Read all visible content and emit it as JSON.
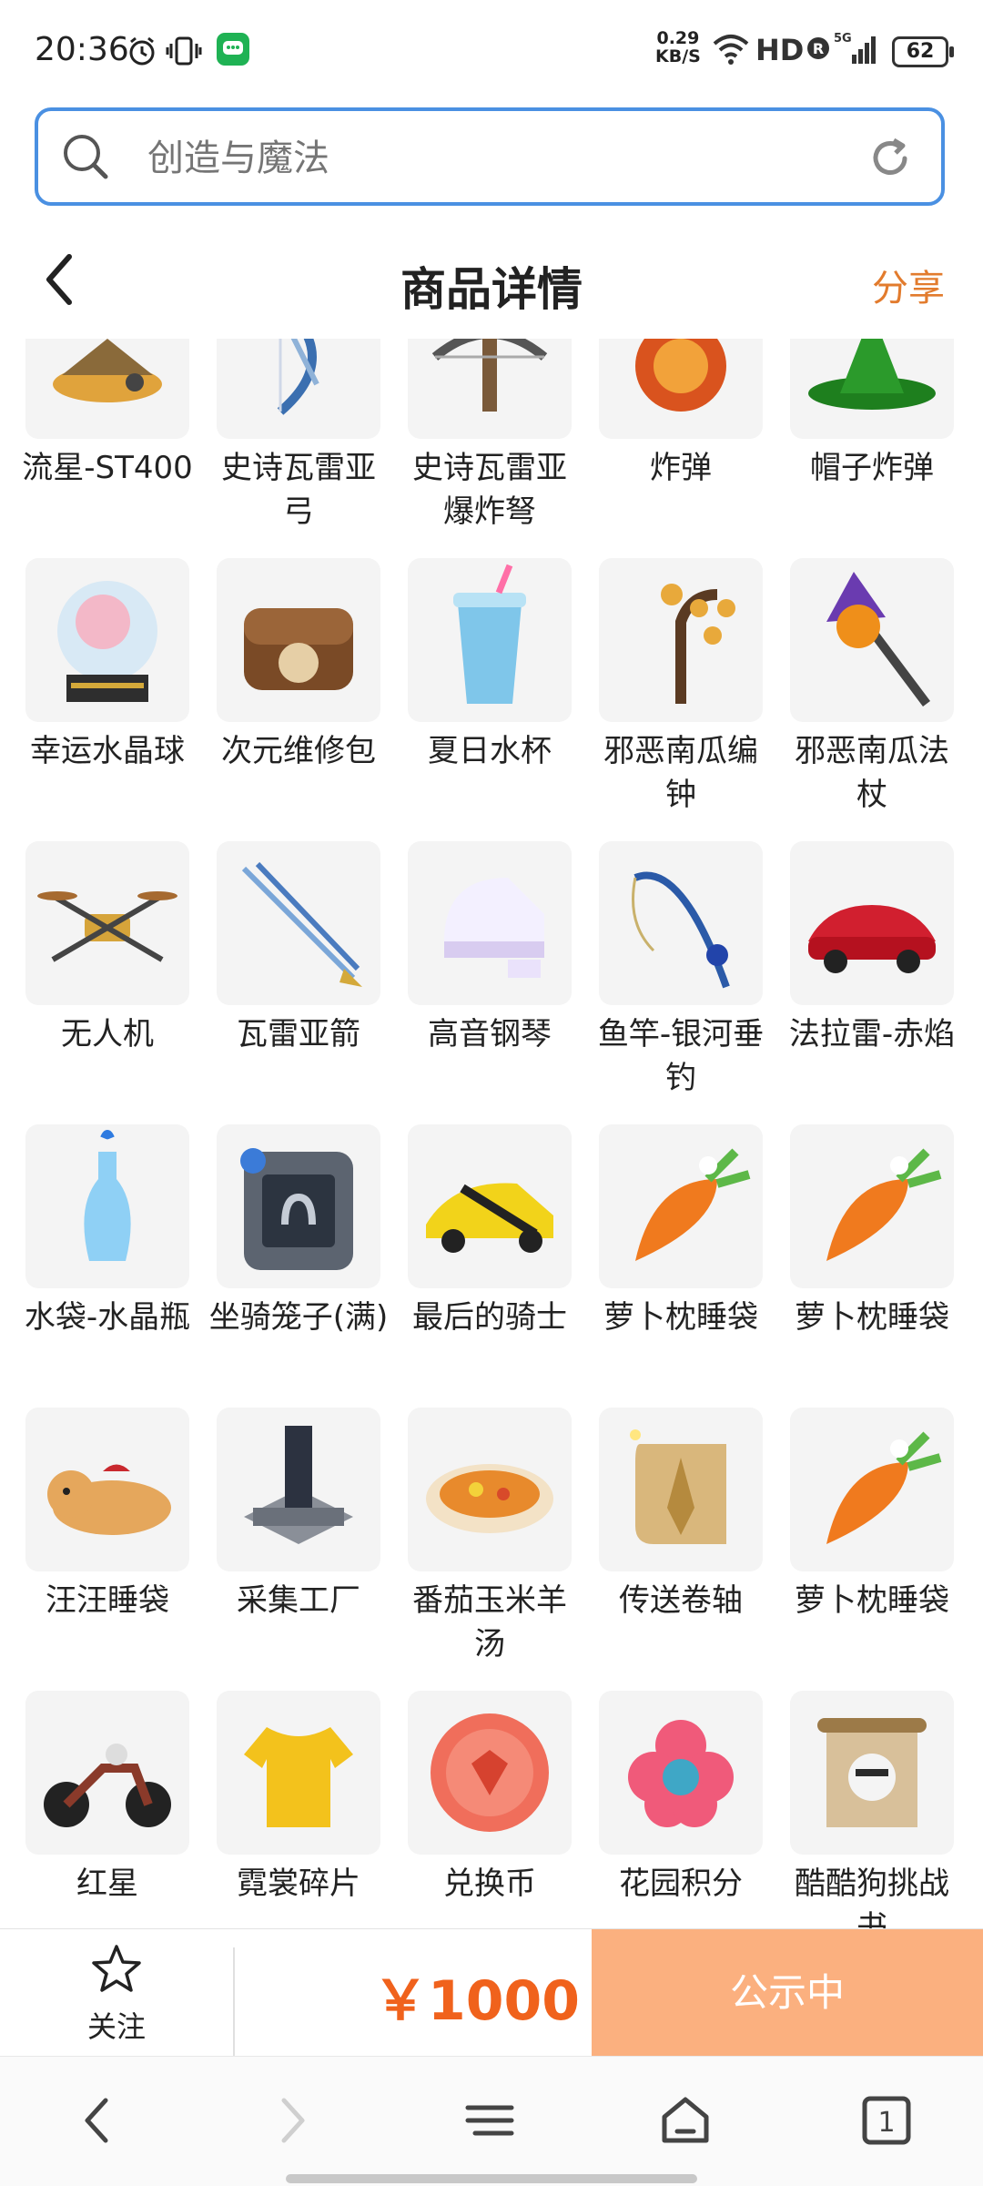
{
  "status_bar": {
    "time": "20:36",
    "net_speed_value": "0.29",
    "net_speed_unit": "KB/S",
    "hd": "HD",
    "battery": "62"
  },
  "search": {
    "placeholder": "创造与魔法"
  },
  "header": {
    "title": "商品详情",
    "share": "分享"
  },
  "items": [
    {
      "name": "流星-ST400",
      "icon": "hovercraft-icon"
    },
    {
      "name": "史诗瓦雷亚弓",
      "icon": "bow-icon"
    },
    {
      "name": "史诗瓦雷亚爆炸弩",
      "icon": "crossbow-icon"
    },
    {
      "name": "炸弹",
      "icon": "bomb-icon"
    },
    {
      "name": "帽子炸弹",
      "icon": "hat-bomb-icon"
    },
    {
      "name": "幸运水晶球",
      "icon": "crystal-ball-icon"
    },
    {
      "name": "次元维修包",
      "icon": "repair-bag-icon"
    },
    {
      "name": "夏日水杯",
      "icon": "cup-icon"
    },
    {
      "name": "邪恶南瓜编钟",
      "icon": "bell-tree-icon"
    },
    {
      "name": "邪恶南瓜法杖",
      "icon": "pumpkin-staff-icon"
    },
    {
      "name": "无人机",
      "icon": "drone-icon"
    },
    {
      "name": "瓦雷亚箭",
      "icon": "arrows-icon"
    },
    {
      "name": "高音钢琴",
      "icon": "piano-icon"
    },
    {
      "name": "鱼竿-银河垂钓",
      "icon": "fishing-rod-icon"
    },
    {
      "name": "法拉雷-赤焰",
      "icon": "red-car-icon"
    },
    {
      "name": "水袋-水晶瓶",
      "icon": "water-bottle-icon"
    },
    {
      "name": "坐骑笼子(满)",
      "icon": "cage-icon"
    },
    {
      "name": "最后的骑士",
      "icon": "yellow-car-icon"
    },
    {
      "name": "萝卜枕睡袋",
      "icon": "carrot-icon"
    },
    {
      "name": "萝卜枕睡袋",
      "icon": "carrot-icon"
    },
    {
      "name": "汪汪睡袋",
      "icon": "dog-icon"
    },
    {
      "name": "采集工厂",
      "icon": "factory-icon"
    },
    {
      "name": "番茄玉米羊汤",
      "icon": "soup-icon"
    },
    {
      "name": "传送卷轴",
      "icon": "scroll-icon"
    },
    {
      "name": "萝卜枕睡袋",
      "icon": "carrot-icon"
    },
    {
      "name": "红星",
      "icon": "motorcycle-icon"
    },
    {
      "name": "霓裳碎片",
      "icon": "shirt-icon"
    },
    {
      "name": "兑换币",
      "icon": "coin-icon"
    },
    {
      "name": "花园积分",
      "icon": "flower-icon"
    },
    {
      "name": "酷酷狗挑战书",
      "icon": "wanted-poster-icon"
    }
  ],
  "action_bar": {
    "follow": "关注",
    "price": "￥1000",
    "status": "公示中"
  },
  "nav": {
    "tabs_count": "1"
  }
}
